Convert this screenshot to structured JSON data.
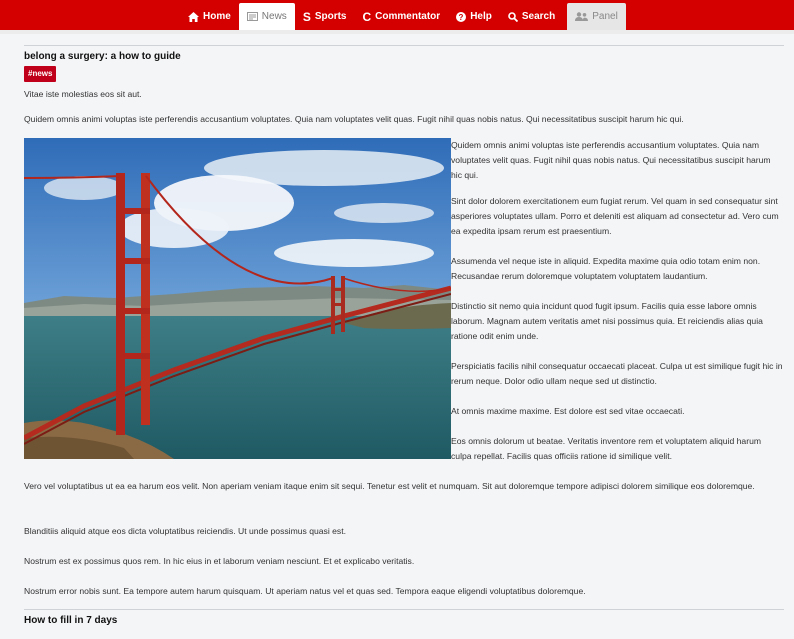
{
  "nav": {
    "items": [
      {
        "label": "Home",
        "icon": "home-icon"
      },
      {
        "label": "News",
        "icon": "newspaper-icon"
      },
      {
        "label": "Sports",
        "icon": "dollar-s-icon"
      },
      {
        "label": "Commentator",
        "icon": "c-logo-icon"
      },
      {
        "label": "Help",
        "icon": "question-circle-icon"
      },
      {
        "label": "Search",
        "icon": "search-icon"
      },
      {
        "label": "Panel",
        "icon": "users-icon"
      }
    ],
    "active": "News",
    "colors": {
      "bar": "#d40000",
      "tag": "#c0001a"
    }
  },
  "article": {
    "title": "belong a surgery: a how to guide",
    "tag": "#news",
    "lead": "Vitae iste molestias eos sit aut.",
    "intro": "Quidem omnis animi voluptas iste perferendis accusantium voluptates. Quia nam voluptates velit quas. Fugit nihil quas nobis natus. Qui necessitatibus suscipit harum hic qui.",
    "image": "golden-gate-bridge-photo",
    "side_paragraphs": [
      "Quidem omnis animi voluptas iste perferendis accusantium voluptates. Quia nam voluptates velit quas. Fugit nihil quas nobis natus. Qui necessitatibus suscipit harum hic qui.",
      "Sint dolor dolorem exercitationem eum fugiat rerum. Vel quam in sed consequatur sint asperiores voluptates ullam. Porro et deleniti est aliquam ad consectetur ad. Vero cum ea expedita ipsam rerum est praesentium.",
      "Assumenda vel neque iste in aliquid. Expedita maxime quia odio totam enim non. Recusandae rerum doloremque voluptatem voluptatem laudantium.",
      "Distinctio sit nemo quia incidunt quod fugit ipsum. Facilis quia esse labore omnis laborum. Magnam autem veritatis amet nisi possimus quia. Et reiciendis alias quia ratione odit enim unde.",
      "Perspiciatis facilis nihil consequatur occaecati placeat. Culpa ut est similique fugit hic in rerum neque. Dolor odio ullam neque sed ut distinctio.",
      "At omnis maxime maxime. Est dolore est sed vitae occaecati.",
      "Eos omnis dolorum ut beatae. Veritatis inventore rem et voluptatem aliquid harum culpa repellat. Facilis quas officiis ratione id similique velit."
    ],
    "body_paragraphs": [
      "Vero vel voluptatibus ut ea ea harum eos velit. Non aperiam veniam itaque enim sit sequi. Tenetur est velit et numquam. Sit aut doloremque tempore adipisci dolorem similique eos doloremque.",
      "Blanditiis aliquid atque eos dicta voluptatibus reiciendis. Ut unde possimus quasi est.",
      "Nostrum est ex possimus quos rem. In hic eius in et laborum veniam nesciunt. Et et explicabo veritatis.",
      "Nostrum error nobis sunt. Ea tempore autem harum quisquam. Ut aperiam natus vel et quas sed. Tempora eaque eligendi voluptatibus doloremque."
    ]
  },
  "next_article": {
    "title": "How to fill in 7 days"
  }
}
